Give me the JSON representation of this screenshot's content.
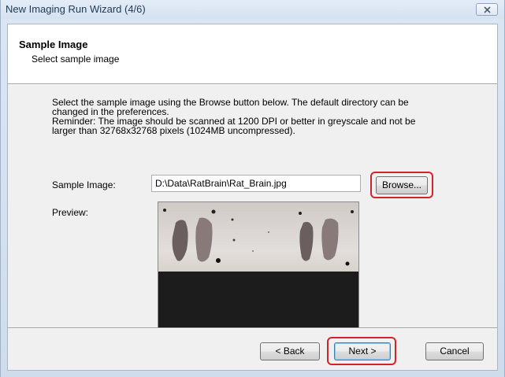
{
  "window": {
    "title": "New Imaging Run Wizard (4/6)"
  },
  "header": {
    "title": "Sample Image",
    "subtitle": "Select sample image"
  },
  "description": {
    "line1": "Select the sample image using the Browse button below. The default directory can be",
    "line2": "changed in the preferences.",
    "line3": "Reminder: The image should be scanned at 1200 DPI or better in greyscale and not be",
    "line4": "larger than 32768x32768 pixels (1024MB uncompressed)."
  },
  "form": {
    "sample_image_label": "Sample Image:",
    "sample_image_value": "D:\\Data\\RatBrain\\Rat_Brain.jpg",
    "browse_label": "Browse...",
    "preview_label": "Preview:"
  },
  "buttons": {
    "back": "< Back",
    "next": "Next >",
    "cancel": "Cancel"
  },
  "colors": {
    "highlight": "#d0242a",
    "client_bg": "#f0f0f0",
    "title_text": "#1e3954"
  },
  "icons": {
    "close": "close-icon"
  }
}
